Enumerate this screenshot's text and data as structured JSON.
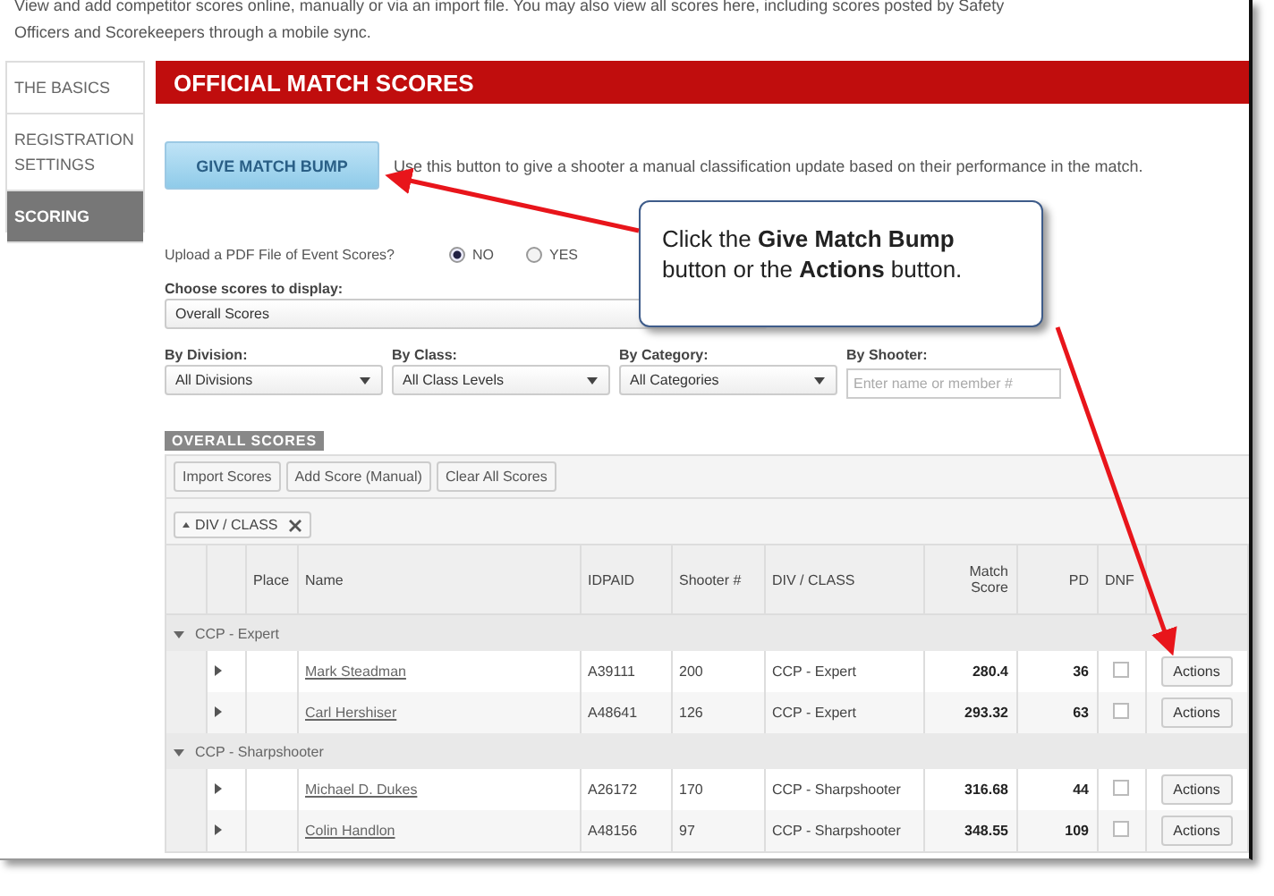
{
  "intro": "View and add competitor scores online, manually or via an import file. You may also view all scores here, including scores posted by Safety Officers and Scorekeepers through a mobile sync.",
  "sidebar": {
    "items": [
      {
        "label": "THE BASICS",
        "selected": false
      },
      {
        "label": "REGISTRATION SETTINGS",
        "selected": false
      },
      {
        "label": "SCORING",
        "selected": true
      }
    ]
  },
  "header": "OFFICIAL MATCH SCORES",
  "bump": {
    "button": "GIVE MATCH BUMP",
    "hint": "Use this button to give a shooter a manual classification update based on their performance in the match."
  },
  "upload": {
    "label": "Upload a PDF File of Event Scores?",
    "options": [
      {
        "label": "NO",
        "selected": true
      },
      {
        "label": "YES",
        "selected": false
      }
    ]
  },
  "choose": {
    "label": "Choose scores to display:",
    "value": "Overall Scores"
  },
  "filters": [
    {
      "label": "By Division:",
      "kind": "select",
      "value": "All Divisions"
    },
    {
      "label": "By Class:",
      "kind": "select",
      "value": "All Class Levels"
    },
    {
      "label": "By Category:",
      "kind": "select",
      "value": "All Categories"
    },
    {
      "label": "By Shooter:",
      "kind": "input",
      "placeholder": "Enter name or member #"
    }
  ],
  "section": "OVERALL SCORES",
  "toolbar": [
    "Import Scores",
    "Add Score (Manual)",
    "Clear All Scores"
  ],
  "group_chip": "DIV / CLASS",
  "table": {
    "columns": [
      "Place",
      "Name",
      "IDPAID",
      "Shooter #",
      "DIV / CLASS",
      "Match Score",
      "PD",
      "DNF"
    ],
    "groups": [
      {
        "label": "CCP - Expert",
        "expanded": true,
        "rows": [
          {
            "name": "Mark Steadman",
            "idpaid": "A39111",
            "shooter": "200",
            "div": "CCP - Expert",
            "score": "280.4",
            "pd": "36",
            "dnf": false,
            "action": "Actions"
          },
          {
            "name": "Carl Hershiser",
            "idpaid": "A48641",
            "shooter": "126",
            "div": "CCP - Expert",
            "score": "293.32",
            "pd": "63",
            "dnf": false,
            "action": "Actions"
          }
        ]
      },
      {
        "label": "CCP - Sharpshooter",
        "expanded": true,
        "rows": [
          {
            "name": "Michael D. Dukes",
            "idpaid": "A26172",
            "shooter": "170",
            "div": "CCP - Sharpshooter",
            "score": "316.68",
            "pd": "44",
            "dnf": false,
            "action": "Actions"
          },
          {
            "name": "Colin Handlon",
            "idpaid": "A48156",
            "shooter": "97",
            "div": "CCP - Sharpshooter",
            "score": "348.55",
            "pd": "109",
            "dnf": false,
            "action": "Actions"
          }
        ]
      }
    ]
  },
  "callout": "Click the **Give Match Bump** button or the **Actions** button."
}
